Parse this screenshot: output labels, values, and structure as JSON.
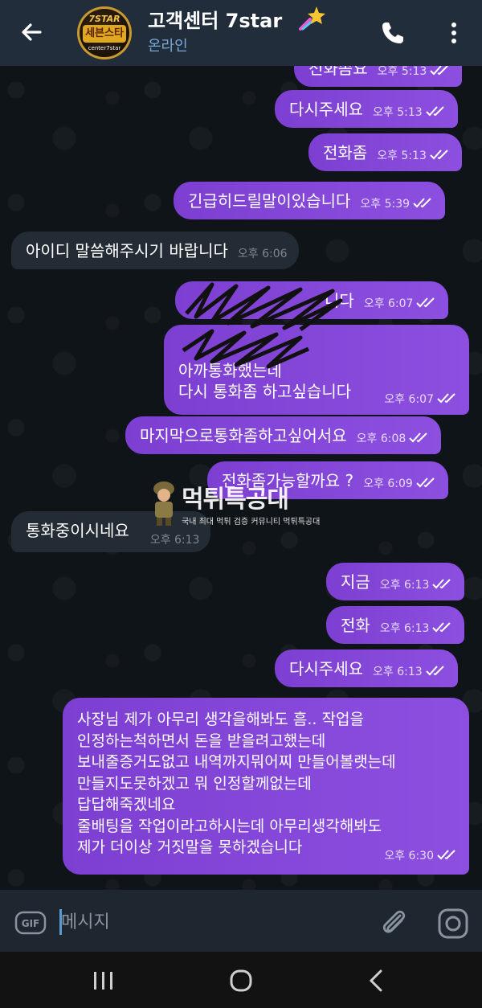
{
  "header": {
    "title": "고객센터 7star",
    "status": "온라인",
    "avatar": {
      "top": "7STAR",
      "mid": "세븐스타",
      "bot": "center7star"
    },
    "colors": {
      "bar": "#212d3b",
      "status": "#7aa9d8"
    }
  },
  "messages": [
    {
      "dir": "out",
      "text": "전화좀요",
      "time": "오후 5:13"
    },
    {
      "dir": "out",
      "text": "다시주세요",
      "time": "오후 5:13"
    },
    {
      "dir": "out",
      "text": "전화좀",
      "time": "오후 5:13"
    },
    {
      "dir": "out",
      "text": "긴급히드릴말이있습니다",
      "time": "오후 5:39"
    },
    {
      "dir": "in",
      "text": "아이디 말씀해주시기 바랍니다",
      "time": "오후 6:06"
    },
    {
      "dir": "out",
      "text": "니다",
      "time": "오후 6:07"
    },
    {
      "dir": "out",
      "text": "아까통화했는데\n다시 통화좀 하고싶습니다",
      "time": "오후 6:07"
    },
    {
      "dir": "out",
      "text": "마지막으로통화좀하고싶어서요",
      "time": "오후 6:08"
    },
    {
      "dir": "out",
      "text": "전화좀가능할까요 ?",
      "time": "오후 6:09"
    },
    {
      "dir": "in",
      "text": "통화중이시네요",
      "time": "오후 6:13"
    },
    {
      "dir": "out",
      "text": "지금",
      "time": "오후 6:13"
    },
    {
      "dir": "out",
      "text": "전화",
      "time": "오후 6:13"
    },
    {
      "dir": "out",
      "text": "다시주세요",
      "time": "오후 6:13"
    },
    {
      "dir": "out",
      "text": "사장님 제가 아무리 생각을해봐도 흠.. 작업을\n인정하는척하면서 돈을 받을려고했는데\n보내줄증거도없고 내역까지뭐어찌 만들어볼랫는데\n만들지도못하겠고 뭐 인정할께없는데\n답답해죽겠네요\n줄배팅을 작업이라고하시는데 아무리생각해봐도\n제가 더이상 거짓말을 못하겠습니다",
      "time": "오후 6:30"
    }
  ],
  "watermark": {
    "title": "먹튀특공대",
    "subtitle": "국내 최대 먹튀 검증 커뮤니티 먹튀특공대"
  },
  "input": {
    "placeholder": "메시지"
  },
  "colors": {
    "outgoing": "#8445d9",
    "incoming": "#232b34",
    "chat_bg": "#0f1419"
  }
}
